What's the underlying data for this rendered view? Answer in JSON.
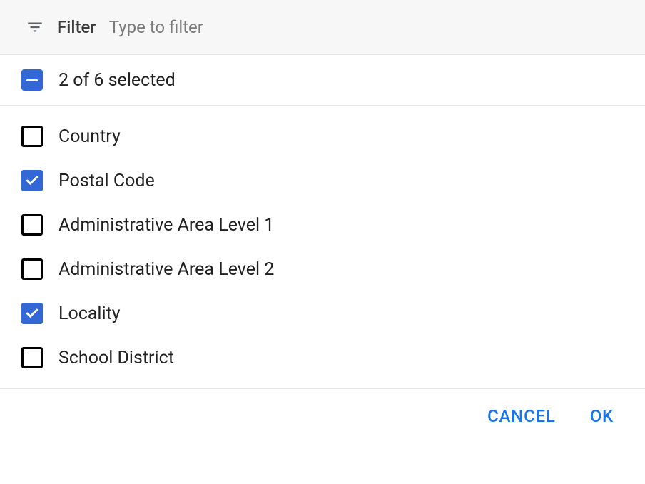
{
  "filter": {
    "label": "Filter",
    "placeholder": "Type to filter"
  },
  "selection": {
    "summary": "2 of 6 selected"
  },
  "options": [
    {
      "label": "Country",
      "checked": false
    },
    {
      "label": "Postal Code",
      "checked": true
    },
    {
      "label": "Administrative Area Level 1",
      "checked": false
    },
    {
      "label": "Administrative Area Level 2",
      "checked": false
    },
    {
      "label": "Locality",
      "checked": true
    },
    {
      "label": "School District",
      "checked": false
    }
  ],
  "actions": {
    "cancel": "CANCEL",
    "ok": "OK"
  }
}
